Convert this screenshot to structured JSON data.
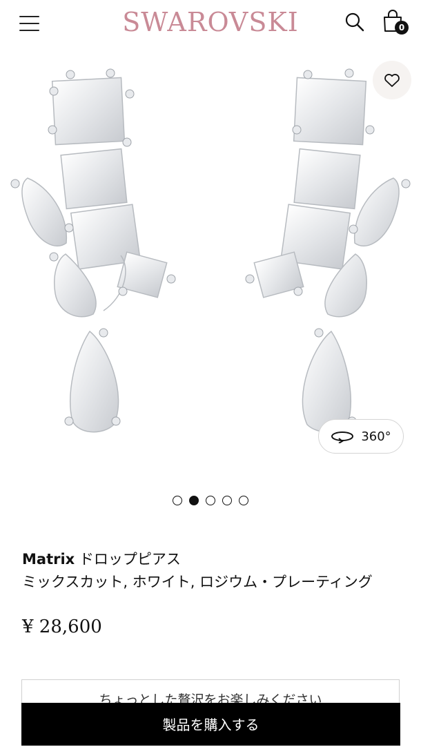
{
  "header": {
    "brand": "SWAROVSKI",
    "cart_count": "0"
  },
  "icons": {
    "menu": "hamburger-icon",
    "search": "search-icon",
    "cart": "shopping-bag-icon",
    "wishlist": "heart-icon",
    "rotate": "rotate-360-icon"
  },
  "gallery": {
    "view_360_label": "360°",
    "slide_count": 5,
    "active_slide": 2
  },
  "product": {
    "name_bold": "Matrix",
    "name_rest": " ドロップピアス",
    "subtitle": "ミックスカット, ホワイト, ロジウム・プレーティング",
    "price": "¥ 28,600"
  },
  "promo_text": "ちょっとした贅沢をお楽しみください",
  "cta": {
    "buy_label": "製品を購入する"
  },
  "colors": {
    "brand": "#c98a96",
    "button": "#000000",
    "wishlist_bg": "#f6f3f1"
  }
}
